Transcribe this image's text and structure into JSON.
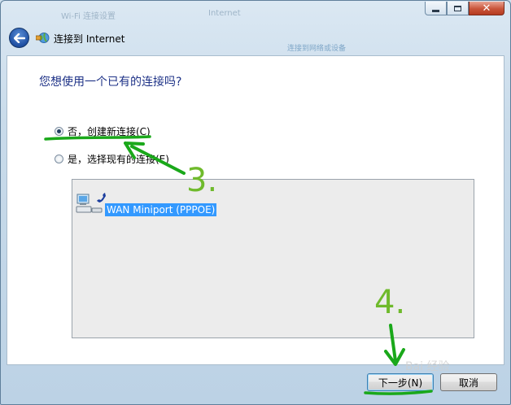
{
  "window": {
    "background_title_left": "Wi-Fi 连接设置",
    "background_title_right": "Internet",
    "background_link": "连接到网络或设备"
  },
  "header": {
    "title": "连接到 Internet"
  },
  "main": {
    "question": "您想使用一个已有的连接吗?",
    "options": [
      {
        "label": "否，创建新连接(C)",
        "selected": true
      },
      {
        "label": "是，选择现有的连接(E)",
        "selected": false
      }
    ],
    "connections": [
      {
        "name": "WAN Miniport (PPPOE)",
        "selected": true
      }
    ]
  },
  "buttons": {
    "next": "下一步(N)",
    "cancel": "取消"
  },
  "annotations": {
    "step3": "3.",
    "step4": "4.",
    "watermark": "Bai 经验",
    "color": "#1aa81a"
  }
}
